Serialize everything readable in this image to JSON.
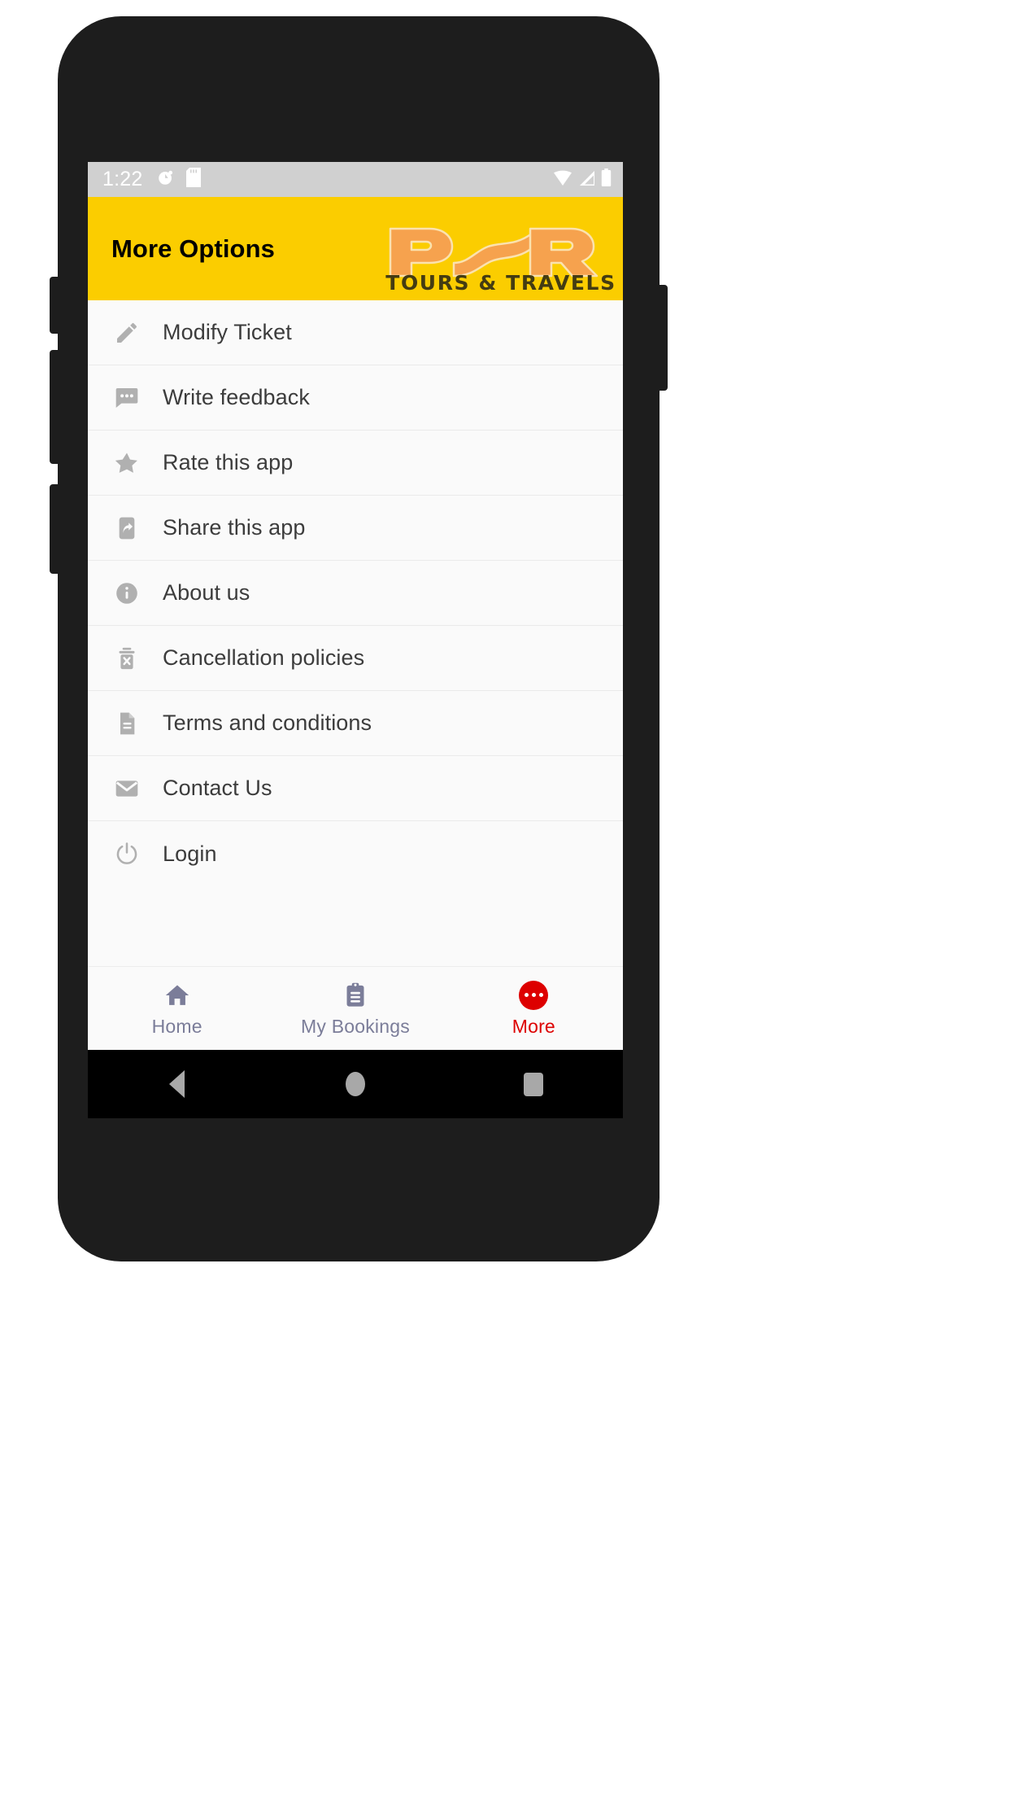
{
  "status_bar": {
    "clock": "1:22",
    "left_icons": [
      "alarm-icon",
      "sd-card-icon"
    ],
    "right_icons": [
      "wifi-icon",
      "cell-signal-icon",
      "battery-icon"
    ]
  },
  "app_bar": {
    "title": "More Options",
    "logo_text": "PSR",
    "logo_subtitle": "TOURS & TRAVELS",
    "background_color": "#FBCD00",
    "logo_color": "#F6A24E",
    "logo_subtitle_color": "#443C12"
  },
  "options": [
    {
      "label": "Modify Ticket",
      "icon": "pencil-icon"
    },
    {
      "label": "Write feedback",
      "icon": "chat-bubble-icon"
    },
    {
      "label": "Rate this app",
      "icon": "star-icon"
    },
    {
      "label": "Share this app",
      "icon": "phone-share-icon"
    },
    {
      "label": "About us",
      "icon": "info-circle-icon"
    },
    {
      "label": "Cancellation policies",
      "icon": "delete-ticket-icon"
    },
    {
      "label": "Terms and conditions",
      "icon": "document-icon"
    },
    {
      "label": "Contact Us",
      "icon": "envelope-icon"
    },
    {
      "label": "Login",
      "icon": "power-icon"
    }
  ],
  "bottom_nav": {
    "active_color": "#DD0000",
    "inactive_color": "#7B7D99",
    "tabs": [
      {
        "label": "Home",
        "icon": "home-icon",
        "active": false
      },
      {
        "label": "My Bookings",
        "icon": "clipboard-icon",
        "active": false
      },
      {
        "label": "More",
        "icon": "more-dots-icon",
        "active": true
      }
    ]
  },
  "system_nav": {
    "back": "back-triangle-icon",
    "home": "home-circle-icon",
    "recents": "recents-square-icon"
  }
}
